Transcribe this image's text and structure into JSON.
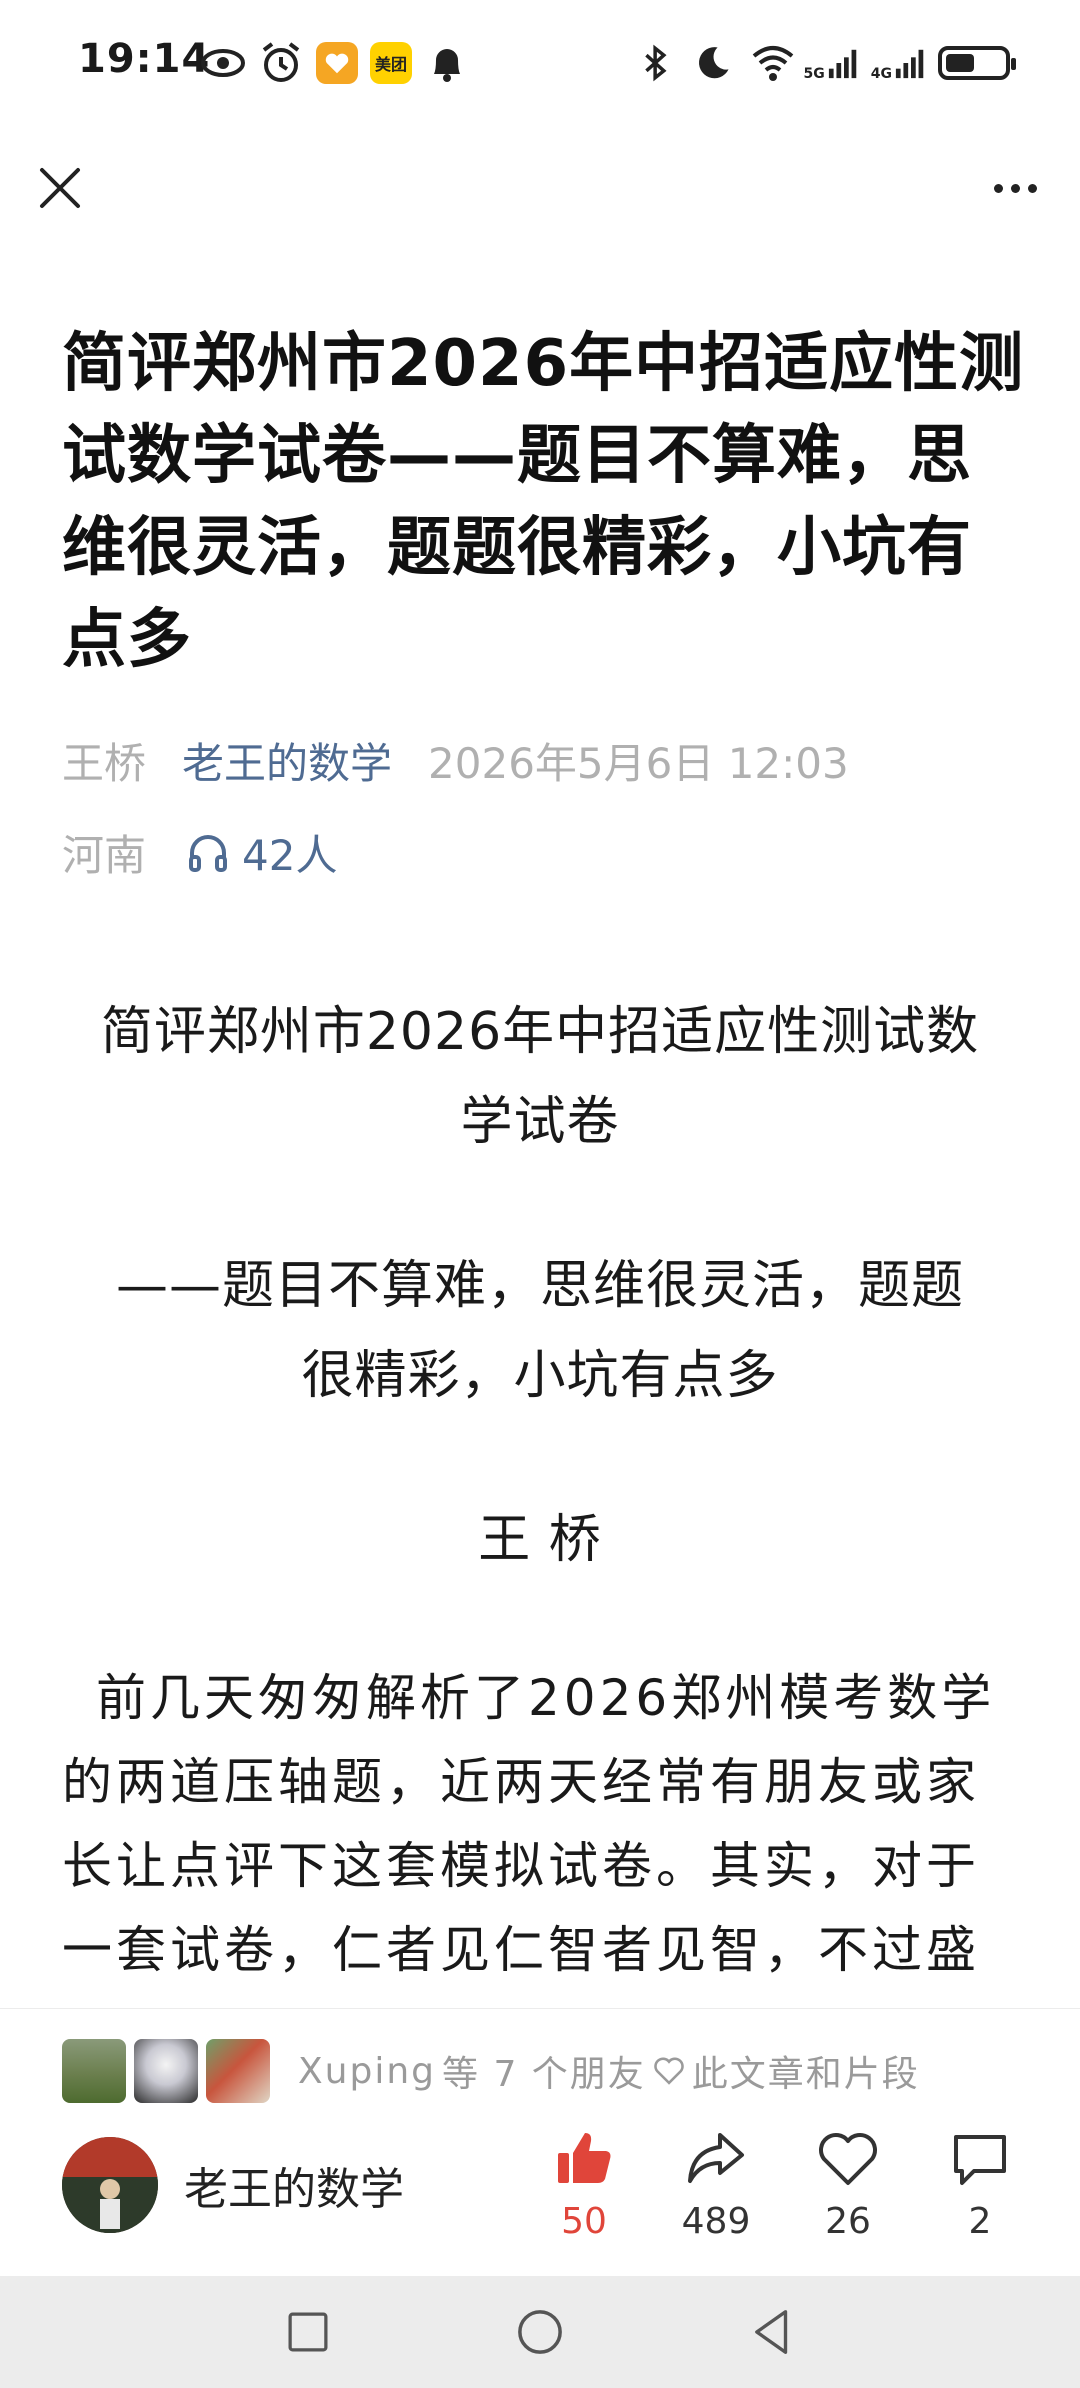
{
  "status_bar": {
    "time": "19:14",
    "left_icons": [
      "eye-icon",
      "alarm-icon",
      "heart-app-icon",
      "meituan-icon",
      "bell-icon"
    ],
    "meituan_label": "美团",
    "network_5g": "5G",
    "network_4g": "4G",
    "battery_level": 0.5
  },
  "article": {
    "title": "简评郑州市2026年中招适应性测试数学试卷——题目不算难，思维很灵活，题题很精彩，小坑有点多",
    "author": "王桥",
    "account": "老王的数学",
    "datetime": "2026年5月6日 12:03",
    "location": "河南",
    "listeners": "42人",
    "body_title_line1": "简评郑州市2026年中招适应性测试数",
    "body_title_line2": "学试卷",
    "body_subtitle_line1": "——题目不算难，思维很灵活，题题",
    "body_subtitle_line2": "很精彩，小坑有点多",
    "body_author": "王 桥",
    "body_paragraph": "前几天匆匆解析了2026郑州模考数学的两道压轴题，近两天经常有朋友或家长让点评下这套模拟试卷。其实，对于一套试卷，仁者见仁智者见智，不过盛情难却，今天也就谈谈想到的东西，不"
  },
  "bottom_bar": {
    "friends_name": "Xuping",
    "friends_text_before": "等 7 个朋友",
    "friends_text_after": "此文章和片段",
    "author_name": "老王的数学",
    "actions": {
      "like": "50",
      "share": "489",
      "favorite": "26",
      "comment": "2"
    }
  },
  "colors": {
    "link": "#4f6b92",
    "like_active": "#e0453a",
    "meta_gray": "#b0b0b0"
  }
}
